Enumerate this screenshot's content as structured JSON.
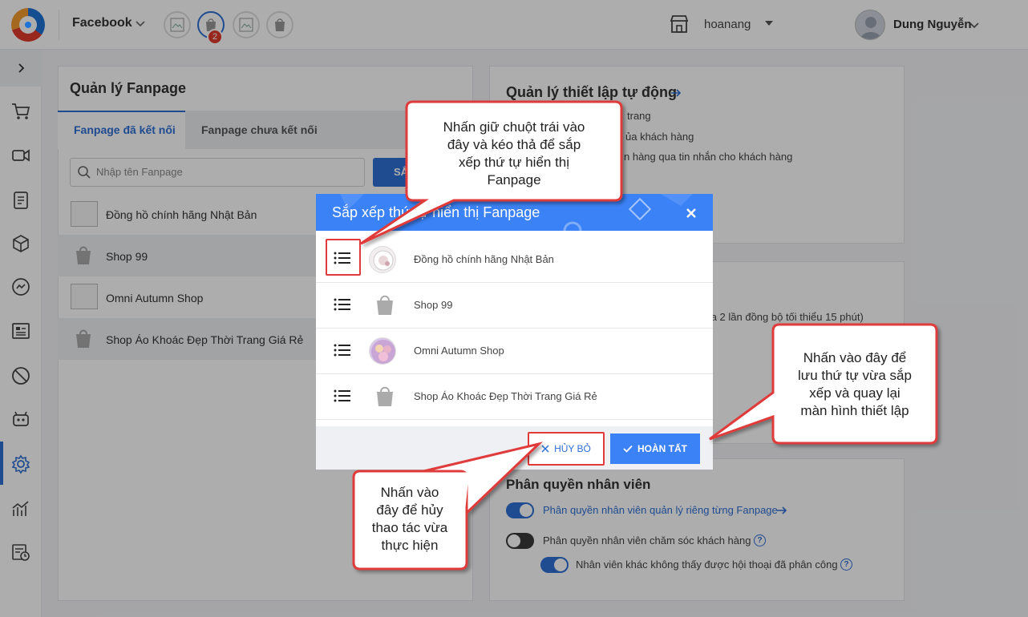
{
  "header": {
    "channel": "Facebook",
    "badge_count": "2",
    "store_name": "hoanang",
    "user_name": "Dung Nguyễn"
  },
  "sidebar": {
    "items": [
      "cart-icon",
      "video-icon",
      "orders-icon",
      "box-icon",
      "messenger-icon",
      "list-icon",
      "block-icon",
      "bot-icon",
      "settings-icon",
      "chart-icon",
      "report-icon"
    ],
    "active": "settings-icon"
  },
  "fanpage_panel": {
    "title": "Quản lý Fanpage",
    "tabs": [
      "Fanpage đã kết nối",
      "Fanpage chưa kết nối"
    ],
    "search_placeholder": "Nhập tên Fanpage",
    "search_button": "SẮ",
    "rows": [
      "Đồng hồ chính hãng Nhật Bản",
      "Shop 99",
      "Omni Autumn Shop",
      "Shop Áo Khoác Đẹp Thời Trang Giá Rẻ"
    ]
  },
  "auto_panel": {
    "title": "Quản lý thiết lập tự động",
    "lines": [
      "trang",
      "ủa khách hàng",
      "n hàng qua tin nhắn cho khách hàng",
      "i"
    ]
  },
  "sync_panel": {
    "line": "ữa 2 lần đồng bộ tối thiểu 15 phút)"
  },
  "staff_panel": {
    "title": "Phân quyền nhân viên",
    "options": [
      {
        "label": "Phân quyền nhân viên quản lý riêng từng Fanpage",
        "on": true,
        "link": true
      },
      {
        "label": "Phân quyền nhân viên chăm sóc khách hàng",
        "on": false,
        "help": true
      },
      {
        "label": "Nhân viên khác không thấy được hội thoại đã phân công",
        "on": true,
        "help": true
      }
    ]
  },
  "modal": {
    "title": "Sắp xếp thứ tự hiển thị Fanpage",
    "title_visible": "Sắp xếp th",
    "title_visible_end": "hiển thị Fanpage",
    "rows": [
      "Đồng hồ chính hãng Nhật Bản",
      "Shop 99",
      "Omni Autumn Shop",
      "Shop Áo Khoác Đẹp Thời Trang Giá Rẻ"
    ],
    "cancel": "HỦY BỎ",
    "done": "HOÀN TẤT"
  },
  "callouts": {
    "drag": [
      "Nhấn giữ chuột trái vào",
      "đây và kéo thả để sắp",
      "xếp thứ tự hiển thị",
      "Fanpage"
    ],
    "save": [
      "Nhấn vào đây để",
      "lưu thứ tự vừa sắp",
      "xếp và quay lại",
      "màn hình thiết lập"
    ],
    "cancel": [
      "Nhấn vào",
      "đây để hủy",
      "thao tác vừa",
      "thực hiện"
    ]
  },
  "colors": {
    "primary": "#2f6fd6",
    "modal_header": "#3b82f6",
    "callout_border": "#e03a3a"
  }
}
